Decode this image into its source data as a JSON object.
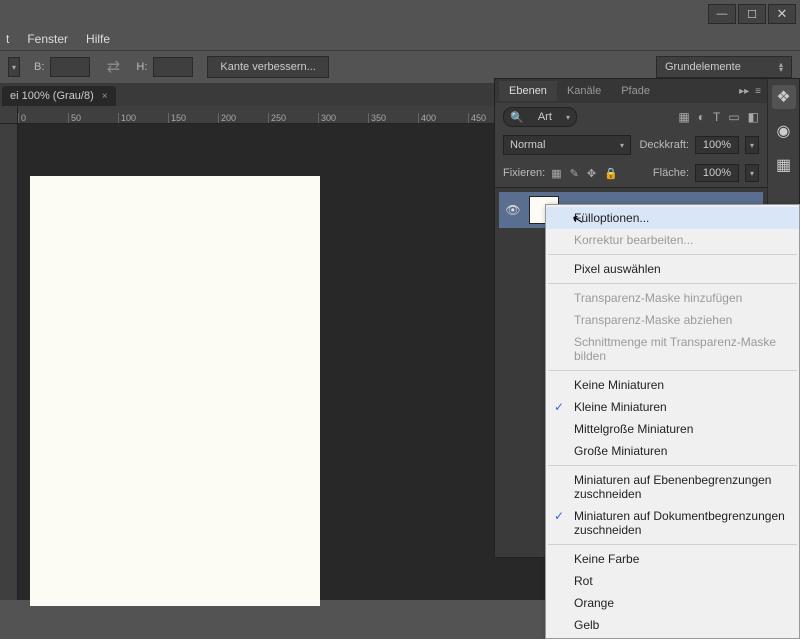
{
  "menubar": {
    "items": [
      "t",
      "Fenster",
      "Hilfe"
    ]
  },
  "window_controls": {
    "min": "—",
    "max": "☐",
    "close": "✕"
  },
  "optionsbar": {
    "b_label": "B:",
    "h_label": "H:",
    "improve_edge": "Kante verbessern...",
    "preset": "Grundelemente"
  },
  "doc_tab": {
    "title": "ei 100% (Grau/8)",
    "close": "×"
  },
  "ruler_marks": [
    "0",
    "50",
    "100",
    "150",
    "200",
    "250",
    "300",
    "350",
    "400",
    "450"
  ],
  "panels": {
    "tabs": [
      "Ebenen",
      "Kanäle",
      "Pfade"
    ],
    "filter": "Art",
    "blend": "Normal",
    "opacity_label": "Deckkraft:",
    "opacity_value": "100%",
    "fill_label": "Fläche:",
    "fill_value": "100%",
    "lock_label": "Fixieren:"
  },
  "context_menu": {
    "items": [
      {
        "label": "Fülloptionen...",
        "enabled": true,
        "highlight": true
      },
      {
        "label": "Korrektur bearbeiten...",
        "enabled": false
      },
      {
        "sep": true
      },
      {
        "label": "Pixel auswählen",
        "enabled": true
      },
      {
        "sep": true
      },
      {
        "label": "Transparenz-Maske hinzufügen",
        "enabled": false
      },
      {
        "label": "Transparenz-Maske abziehen",
        "enabled": false
      },
      {
        "label": "Schnittmenge mit Transparenz-Maske bilden",
        "enabled": false
      },
      {
        "sep": true
      },
      {
        "label": "Keine Miniaturen",
        "enabled": true
      },
      {
        "label": "Kleine Miniaturen",
        "enabled": true,
        "checked": true
      },
      {
        "label": "Mittelgroße Miniaturen",
        "enabled": true
      },
      {
        "label": "Große Miniaturen",
        "enabled": true
      },
      {
        "sep": true
      },
      {
        "label": "Miniaturen auf Ebenenbegrenzungen zuschneiden",
        "enabled": true
      },
      {
        "label": "Miniaturen auf Dokumentbegrenzungen zuschneiden",
        "enabled": true,
        "checked": true
      },
      {
        "sep": true
      },
      {
        "label": "Keine Farbe",
        "enabled": true
      },
      {
        "label": "Rot",
        "enabled": true
      },
      {
        "label": "Orange",
        "enabled": true
      },
      {
        "label": "Gelb",
        "enabled": true
      }
    ]
  }
}
